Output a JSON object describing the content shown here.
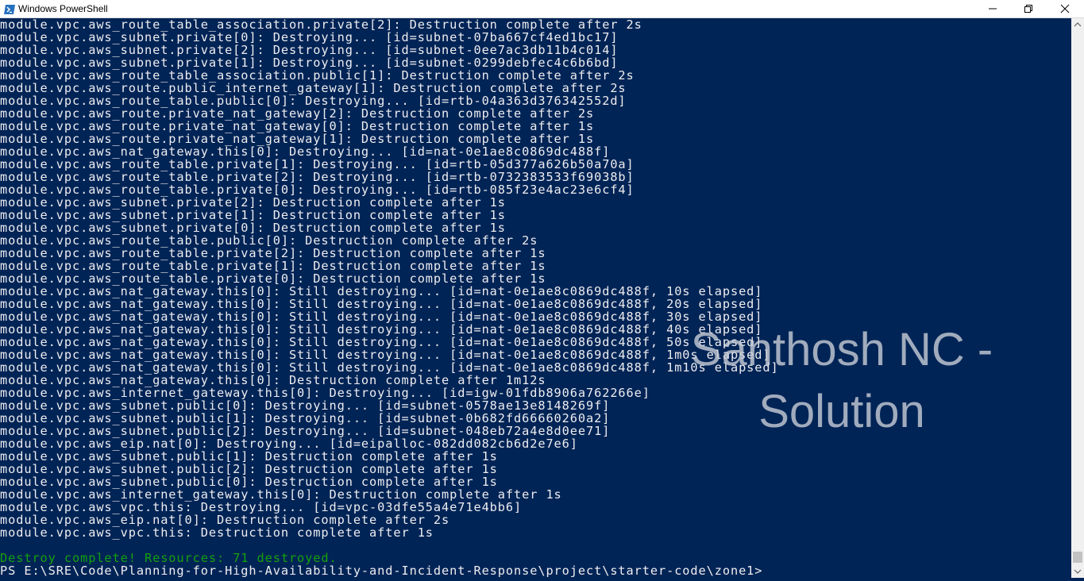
{
  "window": {
    "title": "Windows PowerShell",
    "icon": "powershell-icon",
    "controls": [
      "minimize-icon",
      "restore-icon",
      "close-icon"
    ]
  },
  "colors": {
    "background": "#012456",
    "text": "#eeedf0",
    "success": "#13a10e"
  },
  "console": {
    "lines": [
      "module.vpc.aws_route_table_association.private[2]: Destruction complete after 2s",
      "module.vpc.aws_subnet.private[0]: Destroying... [id=subnet-07ba667cf4ed1bc17]",
      "module.vpc.aws_subnet.private[2]: Destroying... [id=subnet-0ee7ac3db11b4c014]",
      "module.vpc.aws_subnet.private[1]: Destroying... [id=subnet-0299debfec4c6b6bd]",
      "module.vpc.aws_route_table_association.public[1]: Destruction complete after 2s",
      "module.vpc.aws_route.public_internet_gateway[1]: Destruction complete after 2s",
      "module.vpc.aws_route_table.public[0]: Destroying... [id=rtb-04a363d376342552d]",
      "module.vpc.aws_route.private_nat_gateway[2]: Destruction complete after 2s",
      "module.vpc.aws_route.private_nat_gateway[0]: Destruction complete after 1s",
      "module.vpc.aws_route.private_nat_gateway[1]: Destruction complete after 1s",
      "module.vpc.aws_nat_gateway.this[0]: Destroying... [id=nat-0e1ae8c0869dc488f]",
      "module.vpc.aws_route_table.private[1]: Destroying... [id=rtb-05d377a626b50a70a]",
      "module.vpc.aws_route_table.private[2]: Destroying... [id=rtb-0732383533f69038b]",
      "module.vpc.aws_route_table.private[0]: Destroying... [id=rtb-085f23e4ac23e6cf4]",
      "module.vpc.aws_subnet.private[2]: Destruction complete after 1s",
      "module.vpc.aws_subnet.private[1]: Destruction complete after 1s",
      "module.vpc.aws_subnet.private[0]: Destruction complete after 1s",
      "module.vpc.aws_route_table.public[0]: Destruction complete after 2s",
      "module.vpc.aws_route_table.private[2]: Destruction complete after 1s",
      "module.vpc.aws_route_table.private[1]: Destruction complete after 1s",
      "module.vpc.aws_route_table.private[0]: Destruction complete after 1s",
      "module.vpc.aws_nat_gateway.this[0]: Still destroying... [id=nat-0e1ae8c0869dc488f, 10s elapsed]",
      "module.vpc.aws_nat_gateway.this[0]: Still destroying... [id=nat-0e1ae8c0869dc488f, 20s elapsed]",
      "module.vpc.aws_nat_gateway.this[0]: Still destroying... [id=nat-0e1ae8c0869dc488f, 30s elapsed]",
      "module.vpc.aws_nat_gateway.this[0]: Still destroying... [id=nat-0e1ae8c0869dc488f, 40s elapsed]",
      "module.vpc.aws_nat_gateway.this[0]: Still destroying... [id=nat-0e1ae8c0869dc488f, 50s elapsed]",
      "module.vpc.aws_nat_gateway.this[0]: Still destroying... [id=nat-0e1ae8c0869dc488f, 1m0s elapsed]",
      "module.vpc.aws_nat_gateway.this[0]: Still destroying... [id=nat-0e1ae8c0869dc488f, 1m10s elapsed]",
      "module.vpc.aws_nat_gateway.this[0]: Destruction complete after 1m12s",
      "module.vpc.aws_internet_gateway.this[0]: Destroying... [id=igw-01fdb8906a762266e]",
      "module.vpc.aws_subnet.public[0]: Destroying... [id=subnet-0578ae13e8148269f]",
      "module.vpc.aws_subnet.public[1]: Destroying... [id=subnet-0b682fd66660260a2]",
      "module.vpc.aws_subnet.public[2]: Destroying... [id=subnet-048eb72a4e8d0ee71]",
      "module.vpc.aws_eip.nat[0]: Destroying... [id=eipalloc-082dd082cb6d2e7e6]",
      "module.vpc.aws_subnet.public[1]: Destruction complete after 1s",
      "module.vpc.aws_subnet.public[2]: Destruction complete after 1s",
      "module.vpc.aws_subnet.public[0]: Destruction complete after 1s",
      "module.vpc.aws_internet_gateway.this[0]: Destruction complete after 1s",
      "module.vpc.aws_vpc.this: Destroying... [id=vpc-03dfe55a4e71e4bb6]",
      "module.vpc.aws_eip.nat[0]: Destruction complete after 2s",
      "module.vpc.aws_vpc.this: Destruction complete after 1s",
      "",
      "Destroy complete! Resources: 71 destroyed.",
      "PS E:\\SRE\\Code\\Planning-for-High-Availability-and-Incident-Response\\project\\starter-code\\zone1>"
    ]
  },
  "watermark": {
    "line1": "Santhosh NC -",
    "line2": "Solution"
  },
  "scrollbar": {
    "position": 1.0
  }
}
